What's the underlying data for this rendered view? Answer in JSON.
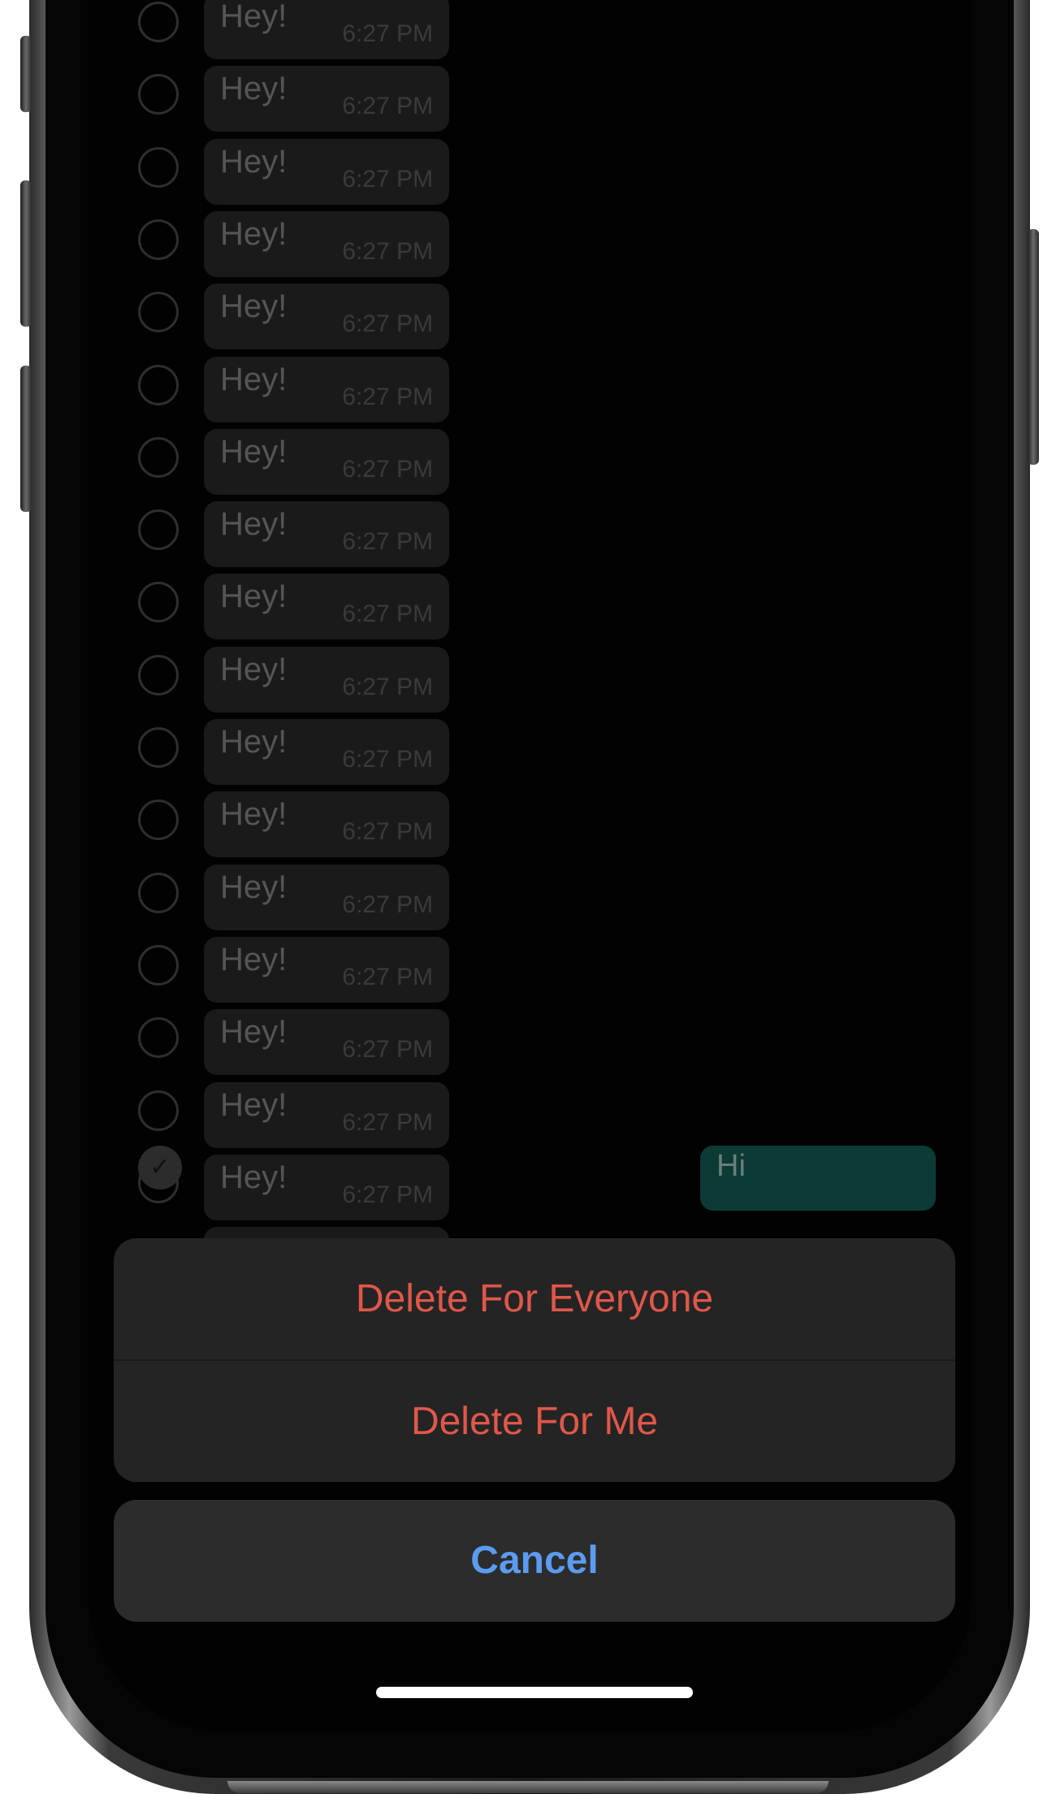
{
  "messages": [
    {
      "text": "Hey!",
      "time": "6:27 PM"
    },
    {
      "text": "Hey!",
      "time": "6:27 PM"
    },
    {
      "text": "Hey!",
      "time": "6:27 PM"
    },
    {
      "text": "Hey!",
      "time": "6:27 PM"
    },
    {
      "text": "Hey!",
      "time": "6:27 PM"
    },
    {
      "text": "Hey!",
      "time": "6:27 PM"
    },
    {
      "text": "Hey!",
      "time": "6:27 PM"
    },
    {
      "text": "Hey!",
      "time": "6:27 PM"
    },
    {
      "text": "Hey!",
      "time": "6:27 PM"
    },
    {
      "text": "Hey!",
      "time": "6:27 PM"
    },
    {
      "text": "Hey!",
      "time": "6:27 PM"
    },
    {
      "text": "Hey!",
      "time": "6:27 PM"
    },
    {
      "text": "Hey!",
      "time": "6:27 PM"
    },
    {
      "text": "Hey!",
      "time": "6:27 PM"
    },
    {
      "text": "Hey!",
      "time": "6:27 PM"
    },
    {
      "text": "Hey!",
      "time": "6:27 PM"
    },
    {
      "text": "Hey!",
      "time": "6:27 PM"
    }
  ],
  "partial_message": {
    "text": "Hi",
    "selected": true
  },
  "action_sheet": {
    "delete_everyone": "Delete For Everyone",
    "delete_me": "Delete For Me",
    "cancel": "Cancel"
  },
  "colors": {
    "destructive": "#e0574a",
    "cancel": "#5b9cf0",
    "sheet_background": "#242424"
  }
}
